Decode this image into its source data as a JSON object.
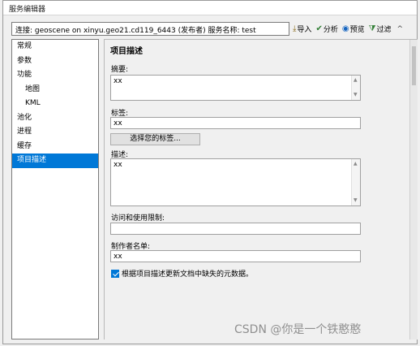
{
  "window": {
    "title": "服务编辑器"
  },
  "connection": {
    "text": "连接: geoscene on xinyu.geo21.cd119_6443 (发布者)   服务名称: test"
  },
  "toolbar": {
    "import_label": "导入",
    "analyze_label": "分析",
    "preview_label": "预览",
    "filter_label": "过滤",
    "collapse_glyph": "^"
  },
  "sidebar": {
    "items": [
      {
        "label": "常规"
      },
      {
        "label": "参数"
      },
      {
        "label": "功能"
      },
      {
        "label": "地图"
      },
      {
        "label": "KML"
      },
      {
        "label": "池化"
      },
      {
        "label": "进程"
      },
      {
        "label": "缓存"
      },
      {
        "label": "项目描述"
      }
    ]
  },
  "content": {
    "section_title": "项目描述",
    "summary": {
      "label": "摘要:",
      "value": "xx"
    },
    "tags": {
      "label": "标签:",
      "value": "xx",
      "choose_button": "选择您的标签..."
    },
    "description": {
      "label": "描述:",
      "value": "xx"
    },
    "access": {
      "label": "访问和使用限制:",
      "value": ""
    },
    "credits": {
      "label": "制作者名单:",
      "value": "xx"
    },
    "update_checkbox": {
      "label": "根据项目描述更新文档中缺失的元数据。",
      "checked": true
    }
  },
  "watermark": "CSDN @你是一个铁憨憨",
  "colors": {
    "accent": "#0078d7",
    "checkbox": "#0078d7"
  }
}
